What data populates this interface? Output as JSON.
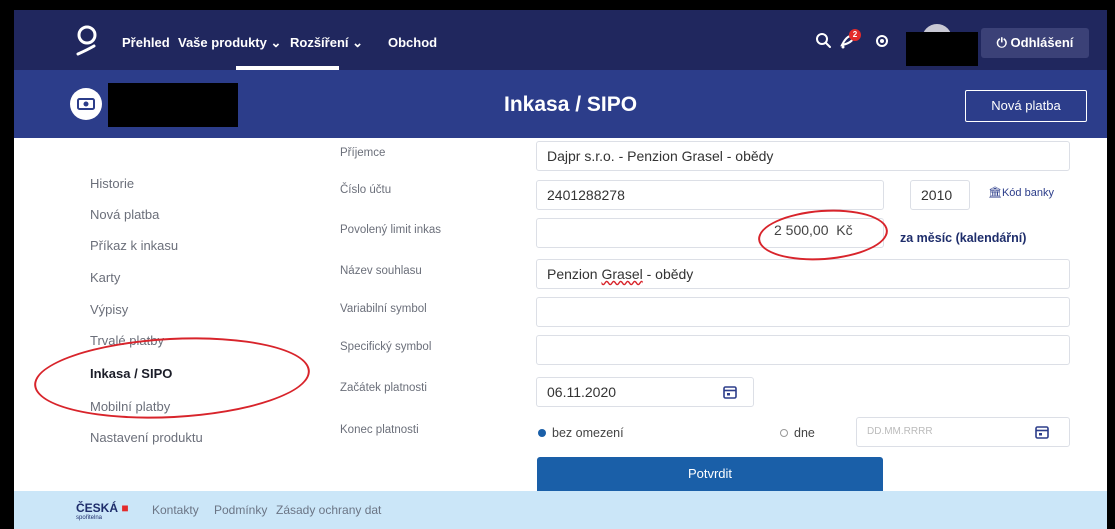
{
  "nav": {
    "items": [
      "Přehled",
      "Vaše produkty",
      "Rozšíření",
      "Obchod"
    ],
    "logout_label": "Odhlášení",
    "notification_count": "2"
  },
  "header": {
    "title": "Inkasa / SIPO",
    "new_payment_label": "Nová platba"
  },
  "sidebar": {
    "items": [
      "Historie",
      "Nová platba",
      "Příkaz k inkasu",
      "Karty",
      "Výpisy",
      "Trvalé platby",
      "Inkasa / SIPO",
      "Mobilní platby",
      "Nastavení produktu"
    ],
    "active": "Inkasa / SIPO"
  },
  "form": {
    "recipient_label": "Příjemce",
    "recipient_value": "Dajpr s.r.o. - Penzion Grasel - obědy",
    "account_label": "Číslo účtu",
    "account_value": "2401288278",
    "bank_code_value": "2010",
    "bank_code_link": "Kód banky",
    "limit_label": "Povolený limit inkas",
    "limit_value": "2 500,00",
    "limit_currency": "Kč",
    "limit_period": "za měsíc (kalendářní)",
    "consent_label": "Název souhlasu",
    "consent_value_prefix": "Penzion ",
    "consent_value_misspelled": "Grasel",
    "consent_value_suffix": " - obědy",
    "variable_label": "Variabilní symbol",
    "variable_value": "",
    "specific_label": "Specifický symbol",
    "specific_value": "",
    "start_label": "Začátek platnosti",
    "start_value": "06.11.2020",
    "end_label": "Konec platnosti",
    "end_option_unlimited": "bez omezení",
    "end_option_date": "dne",
    "end_date_placeholder": "DD.MM.RRRR",
    "confirm_label": "Potvrdit"
  },
  "footer": {
    "brand": "ČESKÁ",
    "brand_sub": "spořitelna",
    "links": [
      "Kontakty",
      "Podmínky",
      "Zásady ochrany dat"
    ]
  },
  "colors": {
    "nav_bg": "#20275e",
    "header_bg": "#2c3d8a",
    "confirm_bg": "#1a5fa8",
    "footer_bg": "#cbe6f8",
    "annotation_red": "#d8242b"
  }
}
